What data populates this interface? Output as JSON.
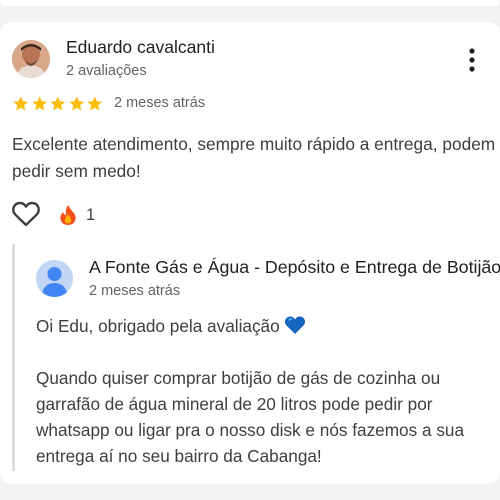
{
  "review": {
    "author": {
      "name": "Eduardo cavalcanti",
      "reviews_count": "2 avaliações",
      "avatar_icon": "user-photo"
    },
    "rating": 5,
    "rating_max": 5,
    "date": "2 meses atrás",
    "text": "Excelente atendimento, sempre muito rápido a entrega, podem pedir sem medo!",
    "reactions": {
      "like_icon": "heart-outline-icon",
      "emoji_icon": "fire-emoji",
      "count": "1"
    },
    "more_icon": "more-vert-icon"
  },
  "owner_reply": {
    "name": "A Fonte Gás e Água - Depósito e Entrega de Botijão de Gás",
    "date": "2 meses atrás",
    "greeting": "Oi Edu, obrigado pela avaliação",
    "greeting_emoji": "blue-heart-emoji",
    "body": "Quando quiser comprar botijão de gás de cozinha ou garrafão de água mineral de 20 litros pode pedir por whatsapp ou ligar pra o nosso disk e nós fazemos a sua entrega aí no seu bairro da Cabanga!"
  },
  "colors": {
    "star": "#fbbc04",
    "primary_text": "#202124",
    "secondary_text": "#5f6368",
    "body_text": "#3c4043",
    "reply_bar": "#dadce0",
    "owner_avatar_bg": "#c2d6f6",
    "owner_avatar_fg": "#4285f4",
    "background": "#f1f3f4"
  }
}
